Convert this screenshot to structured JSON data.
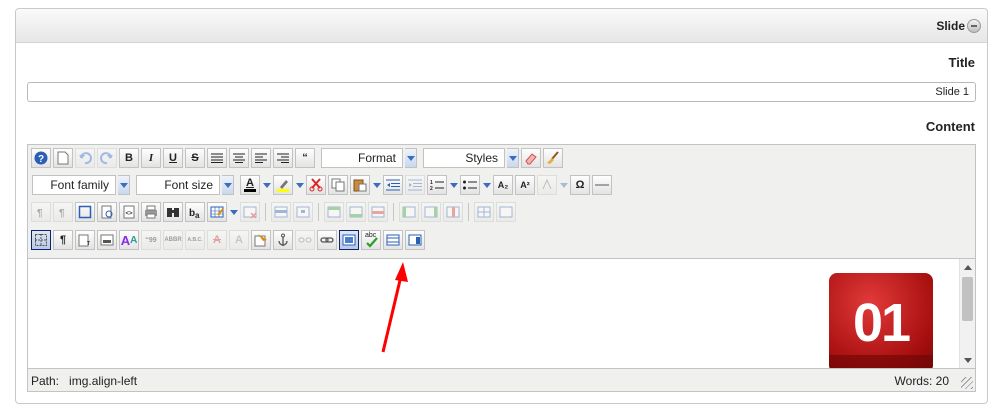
{
  "panel": {
    "title": "Slide"
  },
  "title_field": {
    "label": "Title",
    "value": "Slide 1"
  },
  "content_field": {
    "label": "Content"
  },
  "toolbar": {
    "row1": {
      "buttons": [
        "help-icon",
        "new-document-icon",
        "undo-icon",
        "redo-icon",
        "B",
        "I",
        "U",
        "S",
        "justify-icon",
        "align-center-icon",
        "align-left-icon",
        "align-right-icon",
        "blockquote-icon"
      ],
      "bold": "B",
      "italic": "I",
      "underline": "U",
      "strike": "S",
      "blockquote": "“",
      "format": "Format",
      "styles": "Styles"
    },
    "row2": {
      "font_family": "Font family",
      "font_size": "Font size",
      "forecolor": "A",
      "subscript": "A₂",
      "superscript": "A²",
      "charmap": "Ω"
    },
    "row4": {
      "show_blocks": "¶",
      "fonts": "A",
      "cite": "‘‘99",
      "abbr": "ABBR",
      "acronym": "A.B.C.",
      "del": "A",
      "ins": "A",
      "spell": "abc"
    }
  },
  "image": {
    "text": "01"
  },
  "status": {
    "path_label": "Path:",
    "path_value": "img.align-left",
    "words": "Words: 20"
  },
  "colors": {
    "accent_arrow": "#ff0000",
    "forecolor_bar": "#000000",
    "highlight_bar": "#ffff00"
  }
}
